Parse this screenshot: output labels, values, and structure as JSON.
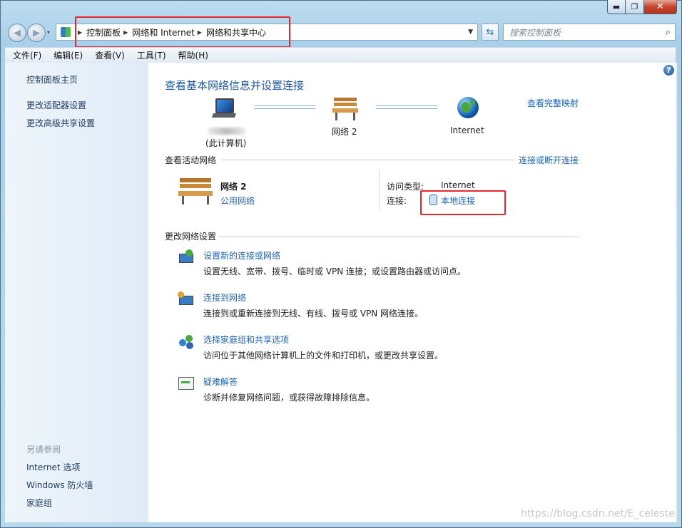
{
  "window": {
    "controls": {
      "minimize": "▬",
      "maximize": "❐",
      "close": "✕"
    },
    "nav": {
      "back_icon": "◀",
      "forward_icon": "▶",
      "dropdown": "▾"
    }
  },
  "address": {
    "crumbs": [
      "控制面板",
      "网络和 Internet",
      "网络和共享中心"
    ],
    "dropdown": "▼",
    "refresh_icon": "⇆"
  },
  "search": {
    "placeholder": "搜索控制面板",
    "icon": "⌕"
  },
  "menu": [
    "文件(F)",
    "编辑(E)",
    "查看(V)",
    "工具(T)",
    "帮助(H)"
  ],
  "sidebar": {
    "top_links": [
      "控制面板主页",
      "更改适配器设置",
      "更改高级共享设置"
    ],
    "see_also_heading": "另请参阅",
    "see_also_links": [
      "Internet 选项",
      "Windows 防火墙",
      "家庭组"
    ]
  },
  "main": {
    "help": "?",
    "heading": "查看基本网络信息并设置连接",
    "full_map_link": "查看完整映射",
    "map": {
      "computer_label": "(此计算机)",
      "network_label": "网络  2",
      "internet_label": "Internet"
    },
    "active_section_title": "查看活动网络",
    "connect_disconnect_link": "连接或断开连接",
    "active_network": {
      "name": "网络  2",
      "type_link": "公用网络",
      "access_type_label": "访问类型:",
      "access_type_value": "Internet",
      "connections_label": "连接:",
      "connection_link": "本地连接"
    },
    "change_section_title": "更改网络设置",
    "tasks": [
      {
        "title": "设置新的连接或网络",
        "desc": "设置无线、宽带、拨号、临时或 VPN 连接；或设置路由器或访问点。"
      },
      {
        "title": "连接到网络",
        "desc": "连接到或重新连接到无线、有线、拨号或 VPN 网络连接。"
      },
      {
        "title": "选择家庭组和共享选项",
        "desc": "访问位于其他网络计算机上的文件和打印机，或更改共享设置。"
      },
      {
        "title": "疑难解答",
        "desc": "诊断并修复网络问题，或获得故障排除信息。"
      }
    ]
  },
  "watermark": "https://blog.csdn.net/E_celeste"
}
